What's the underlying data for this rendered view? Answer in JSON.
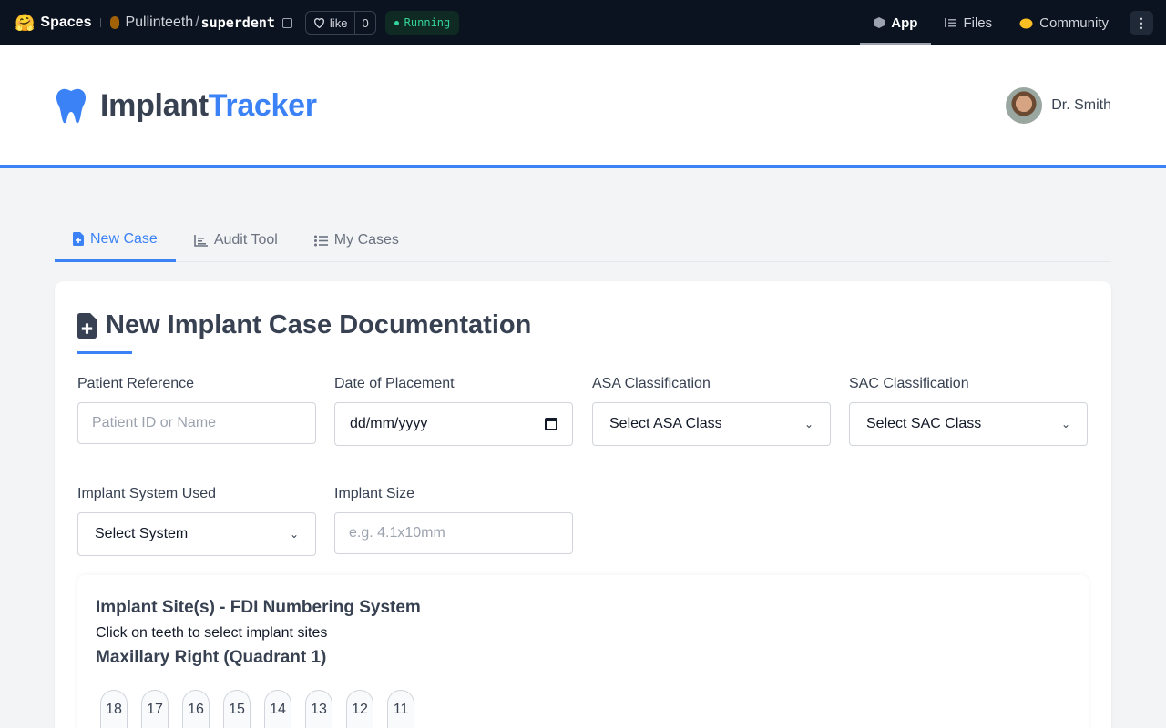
{
  "hf": {
    "spaces_label": "Spaces",
    "owner": "Pullinteeth",
    "repo": "superdent",
    "like_label": "like",
    "like_count": "0",
    "status": "Running",
    "nav": [
      {
        "label": "App",
        "icon": "cube-icon"
      },
      {
        "label": "Files",
        "icon": "files-icon"
      },
      {
        "label": "Community",
        "icon": "community-icon"
      }
    ]
  },
  "header": {
    "brand_main": "Implant",
    "brand_accent": "Tracker",
    "user_name": "Dr. Smith"
  },
  "tabs": [
    {
      "label": "New Case"
    },
    {
      "label": "Audit Tool"
    },
    {
      "label": "My Cases"
    }
  ],
  "form": {
    "title": "New Implant Case Documentation",
    "patient_ref": {
      "label": "Patient Reference",
      "placeholder": "Patient ID or Name"
    },
    "date": {
      "label": "Date of Placement",
      "value": "dd/mm/yyyy"
    },
    "asa": {
      "label": "ASA Classification",
      "value": "Select ASA Class"
    },
    "sac": {
      "label": "SAC Classification",
      "value": "Select SAC Class"
    },
    "system": {
      "label": "Implant System Used",
      "value": "Select System"
    },
    "size": {
      "label": "Implant Size",
      "placeholder": "e.g. 4.1x10mm"
    }
  },
  "sites": {
    "title": "Implant Site(s) - FDI Numbering System",
    "hint": "Click on teeth to select implant sites",
    "quadrant_title": "Maxillary Right (Quadrant 1)",
    "teeth": [
      "18",
      "17",
      "16",
      "15",
      "14",
      "13",
      "12",
      "11"
    ]
  },
  "colors": {
    "accent": "#3b82f6",
    "topbar": "#0b1220",
    "running": "#34d399"
  }
}
